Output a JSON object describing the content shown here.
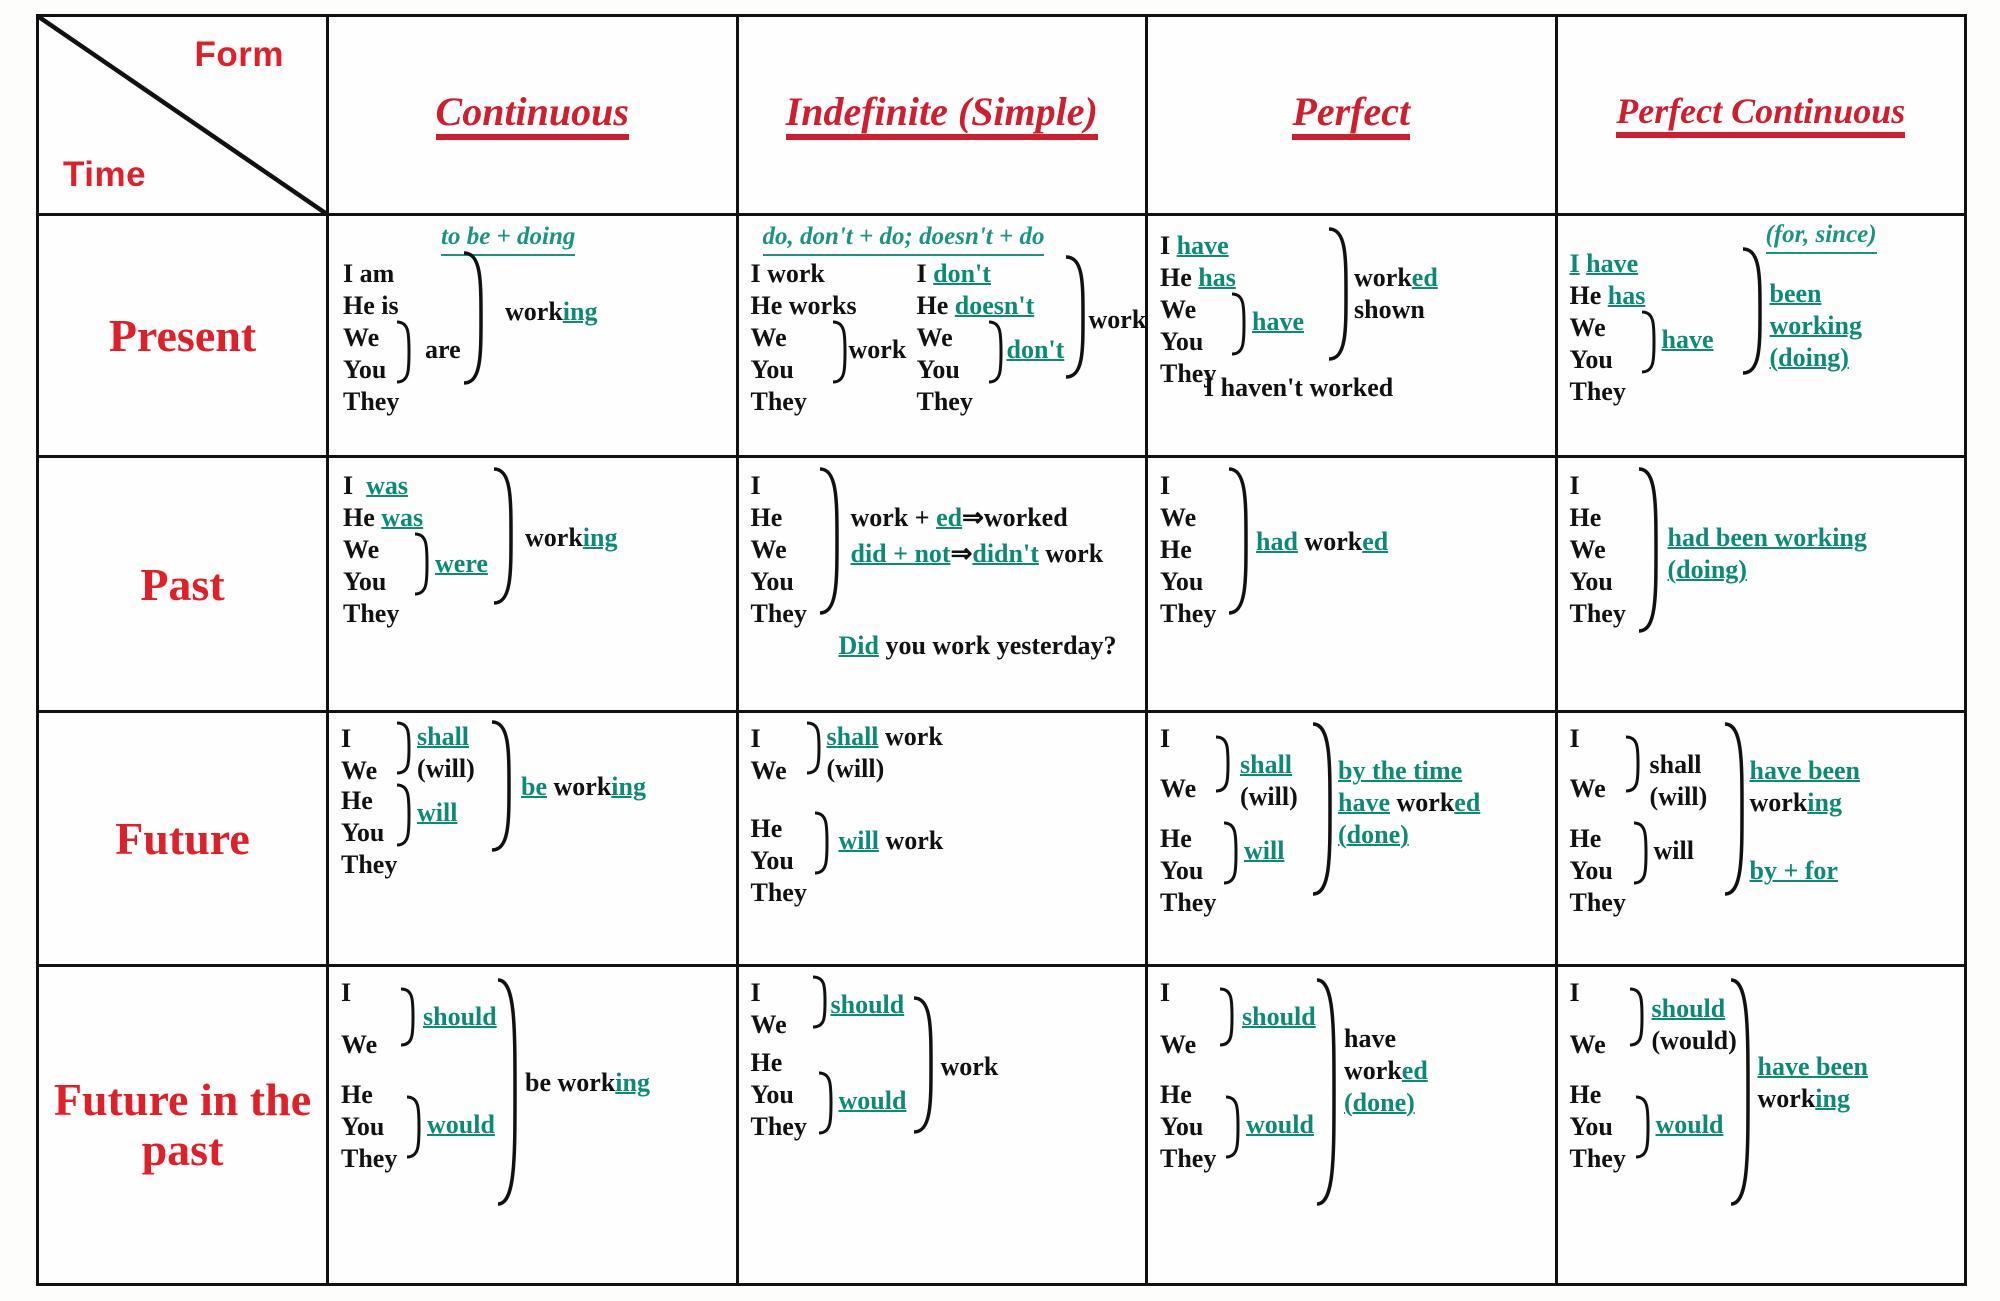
{
  "table": {
    "corner": {
      "form_label": "Form",
      "time_label": "Time",
      "diagonal": true
    },
    "columns": [
      "Continuous",
      "Indefinite (Simple)",
      "Perfect",
      "Perfect Continuous"
    ],
    "rows": [
      "Present",
      "Past",
      "Future",
      "Future in the past"
    ],
    "colors": {
      "header_red": "#cf1f2e",
      "row_red": "#e02028",
      "formula_teal": "#0d8a76",
      "ink": "#111111"
    }
  },
  "cells": {
    "present_continuous": {
      "formula": "to be + doing",
      "pronouns_top": [
        "I am",
        "He is"
      ],
      "pronouns_braced": [
        "We",
        "You",
        "They"
      ],
      "aux": "are",
      "verb_black": "work",
      "verb_teal": "ing"
    },
    "present_indefinite": {
      "formula": "do, don't + do; doesn't + do",
      "affirm_top": [
        "I work",
        "He works"
      ],
      "affirm_s": "s",
      "affirm_braced": [
        "We",
        "You",
        "They"
      ],
      "affirm_verb": "work",
      "neg_top_pronoun1": "I",
      "neg_top_aux1": "don't",
      "neg_top_pronoun2": "He",
      "neg_top_aux2": "doesn't",
      "neg_braced": [
        "We",
        "You",
        "They"
      ],
      "neg_aux": "don't",
      "neg_verb": "work"
    },
    "present_perfect": {
      "line1_pronoun": "I",
      "line1_aux": "have",
      "line2_pronoun": "He",
      "line2_aux": "has",
      "braced": [
        "We",
        "You",
        "They"
      ],
      "aux": "have",
      "participle_black": "work",
      "participle_teal": "ed",
      "participle2": "shown",
      "note": "I haven't worked"
    },
    "present_perfect_continuous": {
      "formula": "(for, since)",
      "line1_pronoun": "I",
      "line1_aux": "have",
      "line2_pronoun": "He",
      "line2_aux": "has",
      "braced": [
        "We",
        "You",
        "They"
      ],
      "aux": "have",
      "result1": "been",
      "result2": "working",
      "result3": "(doing)"
    },
    "past_continuous": {
      "line1_pronoun": "I",
      "line1_aux": "was",
      "line2_pronoun": "He",
      "line2_aux": "was",
      "braced": [
        "We",
        "You",
        "They"
      ],
      "aux": "were",
      "verb_black": "work",
      "verb_teal": "ing"
    },
    "past_indefinite": {
      "braced": [
        "I",
        "He",
        "We",
        "You",
        "They"
      ],
      "rule1_a": "work + ",
      "rule1_b": "ed",
      "rule1_c": "⇒worked",
      "rule2_a": "did + not",
      "rule2_b": "⇒",
      "rule2_c": "didn't",
      "rule2_d": " work",
      "question_a": "Did",
      "question_b": " you work yesterday?"
    },
    "past_perfect": {
      "braced": [
        "I",
        "We",
        "He",
        "You",
        "They"
      ],
      "aux": "had",
      "participle_black": "work",
      "participle_teal": "ed"
    },
    "past_perfect_continuous": {
      "braced": [
        "I",
        "He",
        "We",
        "You",
        "They"
      ],
      "result1": "had been working",
      "result2": "(doing)"
    },
    "future_continuous": {
      "group1": [
        "I",
        "We"
      ],
      "aux1": "shall",
      "aux1_alt": "(will)",
      "group2": [
        "He",
        "You",
        "They"
      ],
      "aux2": "will",
      "result_teal": "be",
      "result_black": "work",
      "result_teal2": "ing"
    },
    "future_indefinite": {
      "group1": [
        "I",
        "We"
      ],
      "aux1": "shall",
      "aux1_alt": "(will)",
      "verb1": "work",
      "group2": [
        "He",
        "You",
        "They"
      ],
      "aux2": "will",
      "verb2": "work"
    },
    "future_perfect": {
      "group1": [
        "I",
        "We"
      ],
      "aux1": "shall",
      "aux1_alt": "(will)",
      "group2": [
        "He",
        "You",
        "They"
      ],
      "aux2": "will",
      "result1": "by the time",
      "result2_teal": "have",
      "result2_black": " work",
      "result2_teal2": "ed",
      "result3": "(done)"
    },
    "future_perfect_continuous": {
      "group1": [
        "I",
        "We"
      ],
      "aux1": "shall",
      "aux1_alt": "(will)",
      "group2": [
        "He",
        "You",
        "They"
      ],
      "aux2": "will",
      "result1": "have been",
      "result2_black": "work",
      "result2_teal": "ing",
      "result3": "by + for"
    },
    "fip_continuous": {
      "group1": [
        "I",
        "We"
      ],
      "aux1": "should",
      "group2": [
        "He",
        "You",
        "They"
      ],
      "aux2": "would",
      "result_black": "be work",
      "result_teal": "ing"
    },
    "fip_indefinite": {
      "group1": [
        "I",
        "We"
      ],
      "aux1": "should",
      "group2": [
        "He",
        "You",
        "They"
      ],
      "aux2": "would",
      "verb": "work"
    },
    "fip_perfect": {
      "group1": [
        "I",
        "We"
      ],
      "aux1": "should",
      "group2": [
        "He",
        "You",
        "They"
      ],
      "aux2": "would",
      "result1": "have",
      "result2_black": "work",
      "result2_teal": "ed",
      "result3": "(done)"
    },
    "fip_perfect_continuous": {
      "group1": [
        "I",
        "We"
      ],
      "aux1": "should",
      "aux1_alt": "(would)",
      "group2": [
        "He",
        "You",
        "They"
      ],
      "aux2": "would",
      "result1": "have been",
      "result2_black": "work",
      "result2_teal": "ing"
    }
  }
}
